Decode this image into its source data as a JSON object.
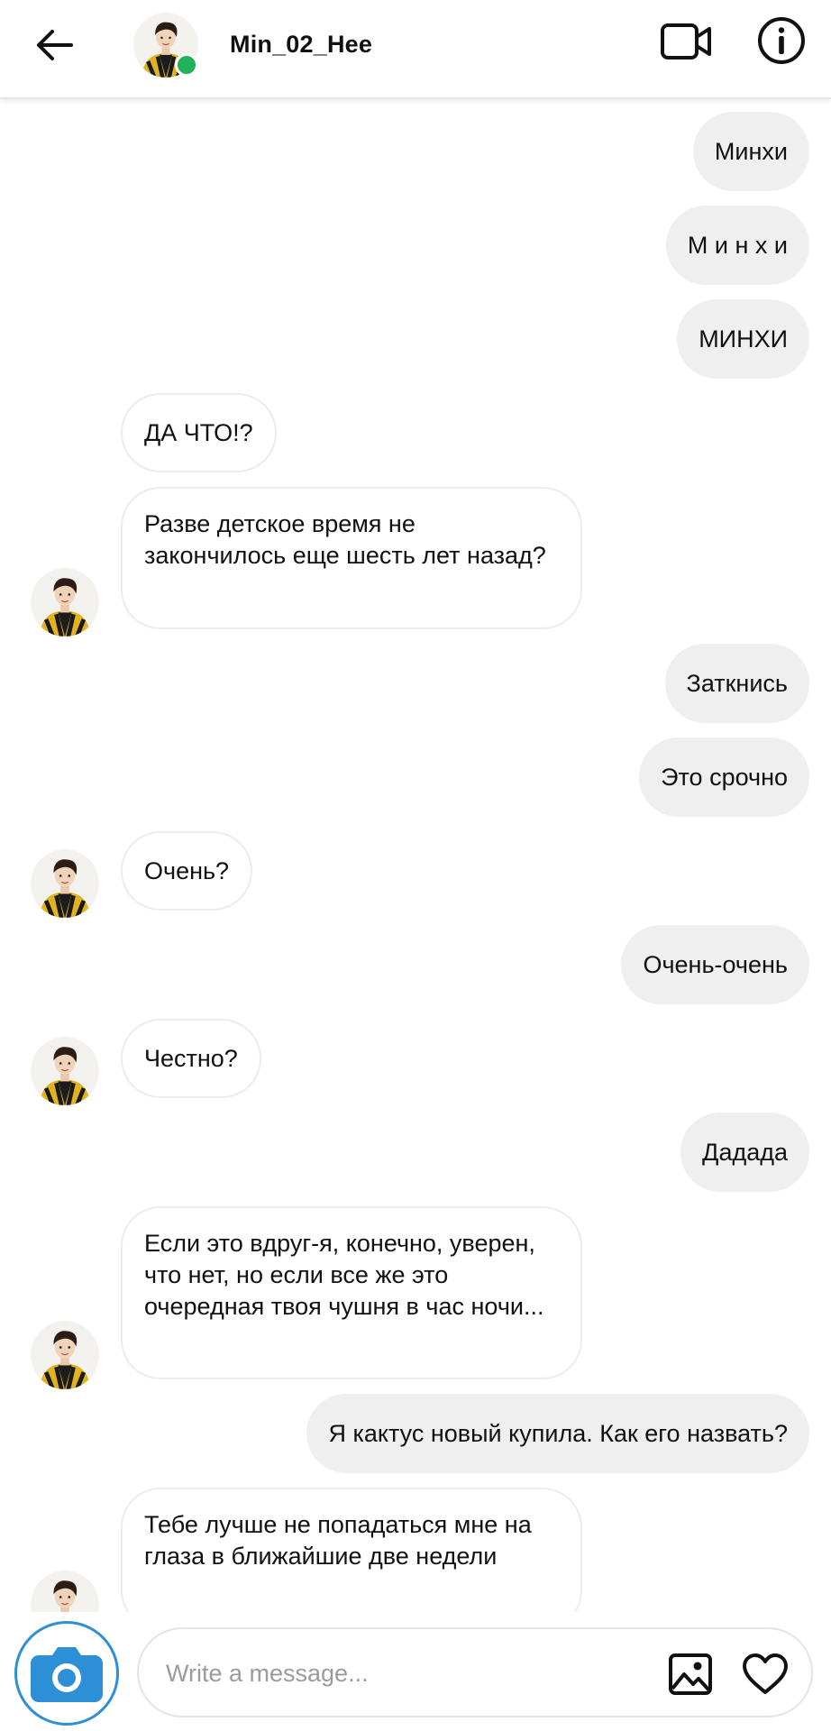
{
  "header": {
    "username": "Min_02_Hee",
    "online": true
  },
  "messages": [
    {
      "side": "out",
      "text": "Минхи"
    },
    {
      "side": "out",
      "text": "М и н х и"
    },
    {
      "side": "out",
      "text": "МИНХИ"
    },
    {
      "side": "in",
      "text": "ДА ЧТО!?",
      "avatar": false
    },
    {
      "side": "in",
      "text": "Разве детское время не закончилось еще шесть лет назад?",
      "avatar": true
    },
    {
      "side": "out",
      "text": "Заткнись"
    },
    {
      "side": "out",
      "text": "Это срочно"
    },
    {
      "side": "in",
      "text": "Очень?",
      "avatar": true
    },
    {
      "side": "out",
      "text": "Очень-очень"
    },
    {
      "side": "in",
      "text": "Честно?",
      "avatar": true
    },
    {
      "side": "out",
      "text": "Дадада"
    },
    {
      "side": "in",
      "text": "Если это вдруг-я, конечно, уверен, что нет, но если все же это очередная твоя чушня в час ночи...",
      "avatar": true
    },
    {
      "side": "out",
      "text": "Я кактус новый купила. Как его назвать?"
    },
    {
      "side": "in",
      "text": "Тебе лучше не попадаться мне на глаза в ближайшие две недели",
      "avatar": true
    }
  ],
  "composer": {
    "placeholder": "Write a message...",
    "value": ""
  },
  "colors": {
    "accent": "#2d8fd5",
    "online": "#22b35a",
    "outgoing_bubble": "#efeff0",
    "incoming_border": "#ececec"
  },
  "icons": [
    "back-arrow-icon",
    "video-camera-icon",
    "info-icon",
    "camera-icon",
    "image-icon",
    "heart-icon"
  ]
}
